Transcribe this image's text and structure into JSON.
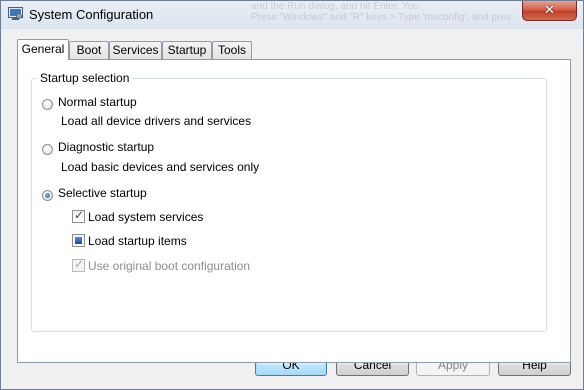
{
  "window": {
    "title": "System Configuration",
    "close_glyph": "✕",
    "background_text": [
      "and the Run dialog, and hit Enter. You",
      "Press \"Windows\" and \"R\" keys > Type 'msconfig', and press"
    ]
  },
  "tabs": [
    {
      "label": "General",
      "active": true
    },
    {
      "label": "Boot",
      "active": false
    },
    {
      "label": "Services",
      "active": false
    },
    {
      "label": "Startup",
      "active": false
    },
    {
      "label": "Tools",
      "active": false
    }
  ],
  "startup_selection": {
    "legend": "Startup selection",
    "normal": {
      "label": "Normal startup",
      "description": "Load all device drivers and services",
      "selected": false
    },
    "diagnostic": {
      "label": "Diagnostic startup",
      "description": "Load basic devices and services only",
      "selected": false
    },
    "selective": {
      "label": "Selective startup",
      "selected": true
    },
    "options": {
      "load_system_services": {
        "label": "Load system services",
        "state": "checked"
      },
      "load_startup_items": {
        "label": "Load startup items",
        "state": "indeterminate"
      },
      "use_original_boot": {
        "label": "Use original boot configuration",
        "state": "checked-disabled"
      }
    }
  },
  "buttons": {
    "ok": "OK",
    "cancel": "Cancel",
    "apply": "Apply",
    "help": "Help"
  },
  "check_glyph": "✓",
  "colors": {
    "accent": "#3c7fb1",
    "close_button": "#c2402b",
    "disabled_text": "#8d8d8d"
  }
}
